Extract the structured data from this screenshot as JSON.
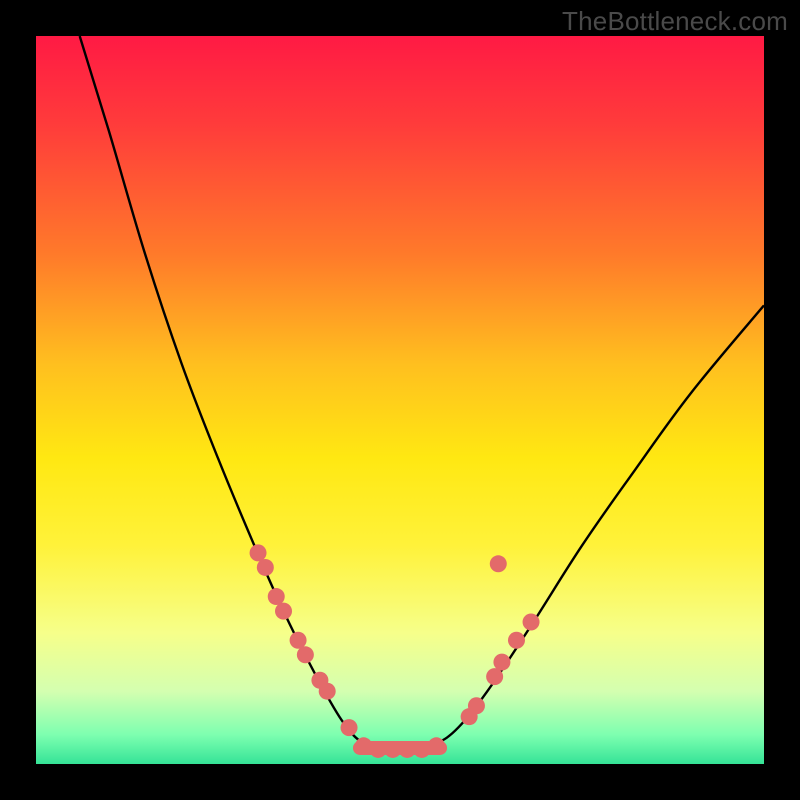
{
  "watermark": "TheBottleneck.com",
  "chart_data": {
    "type": "line",
    "title": "",
    "xlabel": "",
    "ylabel": "",
    "xlim": [
      0,
      100
    ],
    "ylim": [
      0,
      100
    ],
    "grid": false,
    "legend": null,
    "gradient_stops": [
      {
        "offset": 0.0,
        "color": "#ff1a44"
      },
      {
        "offset": 0.12,
        "color": "#ff3b3b"
      },
      {
        "offset": 0.3,
        "color": "#ff7a2a"
      },
      {
        "offset": 0.45,
        "color": "#ffbf1f"
      },
      {
        "offset": 0.58,
        "color": "#ffe812"
      },
      {
        "offset": 0.7,
        "color": "#fff23a"
      },
      {
        "offset": 0.82,
        "color": "#f6ff8a"
      },
      {
        "offset": 0.9,
        "color": "#d4ffb0"
      },
      {
        "offset": 0.96,
        "color": "#7dffb0"
      },
      {
        "offset": 1.0,
        "color": "#35e397"
      }
    ],
    "series": [
      {
        "name": "bottleneck-curve",
        "type": "line",
        "color": "#000000",
        "points": [
          {
            "x": 6.0,
            "y": 100.0
          },
          {
            "x": 10.0,
            "y": 87.0
          },
          {
            "x": 15.0,
            "y": 70.0
          },
          {
            "x": 20.0,
            "y": 55.0
          },
          {
            "x": 25.0,
            "y": 42.0
          },
          {
            "x": 30.0,
            "y": 30.0
          },
          {
            "x": 34.0,
            "y": 21.0
          },
          {
            "x": 38.0,
            "y": 13.0
          },
          {
            "x": 42.0,
            "y": 6.0
          },
          {
            "x": 45.0,
            "y": 2.8
          },
          {
            "x": 48.0,
            "y": 2.0
          },
          {
            "x": 52.0,
            "y": 2.0
          },
          {
            "x": 55.0,
            "y": 2.8
          },
          {
            "x": 58.0,
            "y": 5.0
          },
          {
            "x": 62.0,
            "y": 10.0
          },
          {
            "x": 68.0,
            "y": 19.0
          },
          {
            "x": 75.0,
            "y": 30.0
          },
          {
            "x": 82.0,
            "y": 40.0
          },
          {
            "x": 90.0,
            "y": 51.0
          },
          {
            "x": 100.0,
            "y": 63.0
          }
        ]
      },
      {
        "name": "marker-dots",
        "type": "scatter",
        "color": "#e36a6a",
        "points": [
          {
            "x": 30.5,
            "y": 29.0
          },
          {
            "x": 31.5,
            "y": 27.0
          },
          {
            "x": 33.0,
            "y": 23.0
          },
          {
            "x": 34.0,
            "y": 21.0
          },
          {
            "x": 36.0,
            "y": 17.0
          },
          {
            "x": 37.0,
            "y": 15.0
          },
          {
            "x": 39.0,
            "y": 11.5
          },
          {
            "x": 40.0,
            "y": 10.0
          },
          {
            "x": 43.0,
            "y": 5.0
          },
          {
            "x": 45.0,
            "y": 2.5
          },
          {
            "x": 47.0,
            "y": 2.0
          },
          {
            "x": 49.0,
            "y": 2.0
          },
          {
            "x": 51.0,
            "y": 2.0
          },
          {
            "x": 53.0,
            "y": 2.0
          },
          {
            "x": 55.0,
            "y": 2.5
          },
          {
            "x": 59.5,
            "y": 6.5
          },
          {
            "x": 60.5,
            "y": 8.0
          },
          {
            "x": 63.0,
            "y": 12.0
          },
          {
            "x": 64.0,
            "y": 14.0
          },
          {
            "x": 66.0,
            "y": 17.0
          },
          {
            "x": 68.0,
            "y": 19.5
          },
          {
            "x": 63.5,
            "y": 27.5
          }
        ]
      },
      {
        "name": "flat-bottom-segment",
        "type": "line",
        "color": "#e36a6a",
        "points": [
          {
            "x": 44.5,
            "y": 2.2
          },
          {
            "x": 55.5,
            "y": 2.2
          }
        ]
      }
    ]
  }
}
